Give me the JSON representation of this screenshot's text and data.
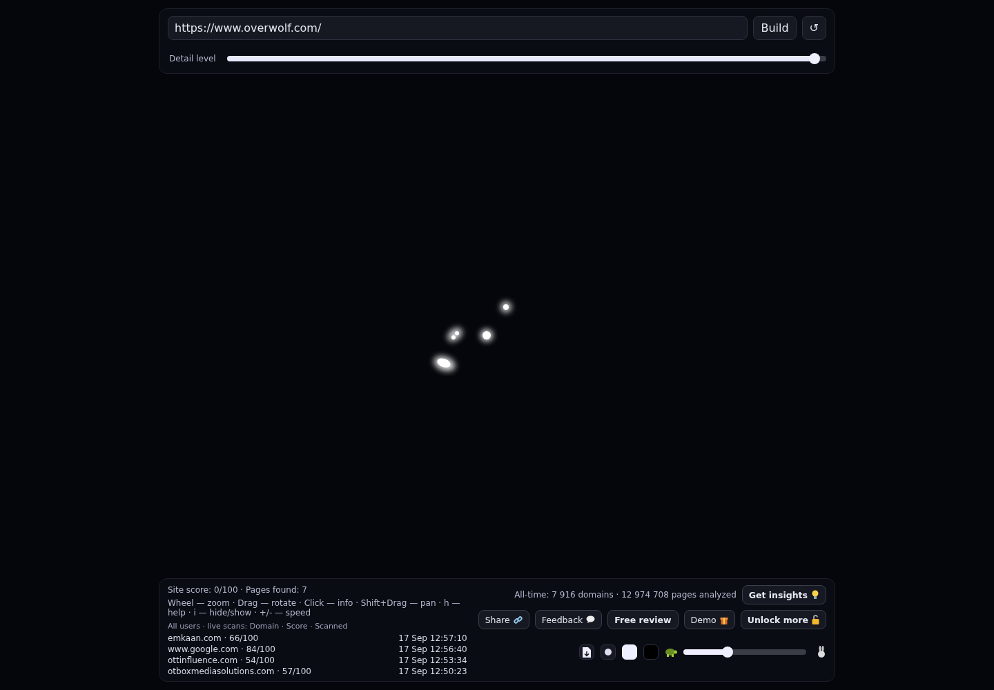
{
  "url_field": {
    "value": "https://www.overwolf.com/"
  },
  "build_button": "Build",
  "reset_button": "↺",
  "detail": {
    "label": "Detail level",
    "level": 0.98
  },
  "status": {
    "summary": "Site score: 0/100 · Pages found: 7",
    "help": "Wheel — zoom · Drag — rotate · Click — info · Shift+Drag — pan · h — help · i — hide/show · +/- — speed",
    "feed_title": "All users · live scans: Domain · Score · Scanned",
    "scans": [
      {
        "domain": "emkaan.com · 66/100",
        "time": "17 Sep 12:57:10"
      },
      {
        "domain": "www.google.com · 84/100",
        "time": "17 Sep 12:56:40"
      },
      {
        "domain": "ottinfluence.com · 54/100",
        "time": "17 Sep 12:53:34"
      },
      {
        "domain": "otboxmediasolutions.com · 57/100",
        "time": "17 Sep 12:50:23"
      }
    ]
  },
  "totals": "All-time: 7 916 domains · 12 974 708 pages analyzed",
  "actions": [
    {
      "label": "Get insights",
      "kind": "bulb",
      "bold": true
    },
    {
      "label": "Share",
      "kind": "link",
      "bold": false
    },
    {
      "label": "Feedback",
      "kind": "chat",
      "bold": false
    },
    {
      "label": "Free review",
      "kind": "none",
      "bold": true
    },
    {
      "label": "Demo",
      "kind": "gift",
      "bold": false
    },
    {
      "label": "Unlock more",
      "kind": "lock",
      "bold": true
    }
  ],
  "speed": {
    "level": 0.36
  }
}
